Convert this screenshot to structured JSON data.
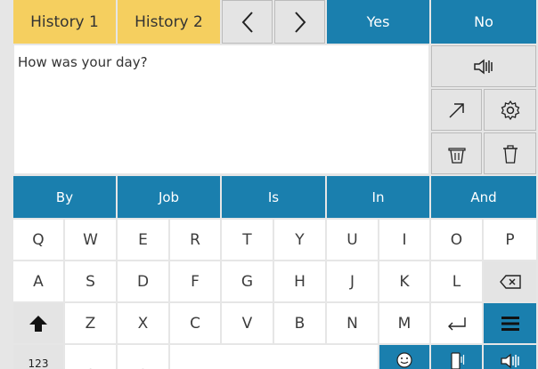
{
  "top_bar": {
    "history1": "History 1",
    "history2": "History 2",
    "back_icon": "chevron-left-icon",
    "forward_icon": "chevron-right-icon",
    "yes": "Yes",
    "no": "No"
  },
  "message": {
    "text": "How was your day?"
  },
  "side_tools": {
    "speak_icon": "speaker-icon",
    "share_icon": "arrow-up-right-icon",
    "settings_icon": "gear-icon",
    "clear_word_icon": "trash-word-icon",
    "clear_all_icon": "trash-icon"
  },
  "predictions": [
    "By",
    "Job",
    "Is",
    "In",
    "And"
  ],
  "keyboard": {
    "row1": [
      "Q",
      "W",
      "E",
      "R",
      "T",
      "Y",
      "U",
      "I",
      "O",
      "P"
    ],
    "row2": [
      "A",
      "S",
      "D",
      "F",
      "G",
      "H",
      "J",
      "K",
      "L"
    ],
    "row3": [
      "Z",
      "X",
      "C",
      "V",
      "B",
      "N",
      "M"
    ],
    "backspace_icon": "backspace-icon",
    "shift_icon": "shift-icon",
    "enter_icon": "enter-icon",
    "menu_icon": "menu-icon",
    "numbers": "123",
    "comma": ",",
    "period": ".",
    "emoji_icon": "emoji-icon",
    "phone_icon": "phone-speaker-icon",
    "speak_icon": "speaker-icon"
  },
  "colors": {
    "accent_blue": "#1a7fae",
    "history_yellow": "#f5cf5f",
    "key_white": "#ffffff",
    "background": "#e6e6e6"
  }
}
